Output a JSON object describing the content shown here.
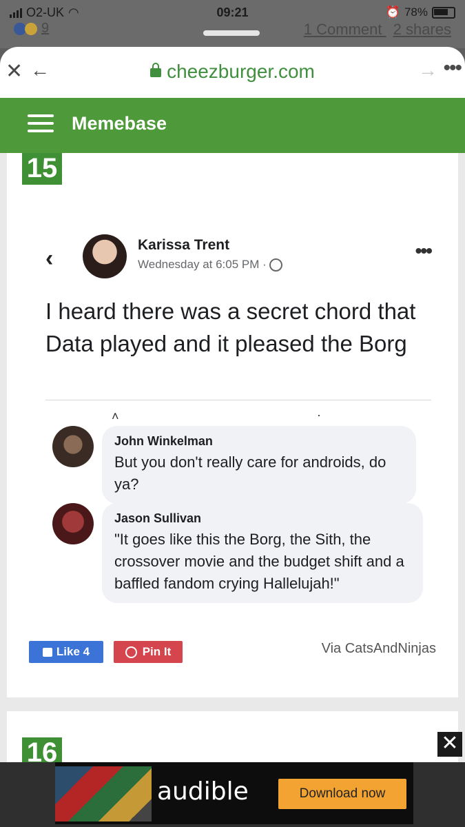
{
  "status_bar": {
    "carrier": "O2-UK",
    "time": "09:21",
    "battery": "78%",
    "reaction_count": "9",
    "comments": "1 Comment",
    "shares": "2 shares"
  },
  "browser": {
    "url": "cheezburger.com"
  },
  "site": {
    "title": "Memebase"
  },
  "items": [
    {
      "number": "15",
      "post": {
        "author": "Karissa Trent",
        "time": "Wednesday at 6:05 PM ·",
        "text": "I heard there was a secret chord that Data played and it pleased the Borg"
      },
      "comments": [
        {
          "author": "John Winkelman",
          "text": "But you don't really care for androids, do ya?"
        },
        {
          "author": "Jason Sullivan",
          "text": "\"It goes like this the Borg, the Sith, the crossover movie and the budget shift and a baffled fandom crying Hallelujah!\""
        }
      ],
      "like_label": "Like 4",
      "pin_label": "Pin It",
      "via": "Via CatsAndNinjas"
    },
    {
      "number": "16"
    }
  ],
  "ad": {
    "brand": "audible",
    "cta": "Download now",
    "close": "✕"
  },
  "colors": {
    "site_green": "#4e9a3a",
    "like_blue": "#3b73d6",
    "pin_red": "#d4454d",
    "ad_orange": "#f3a331"
  }
}
